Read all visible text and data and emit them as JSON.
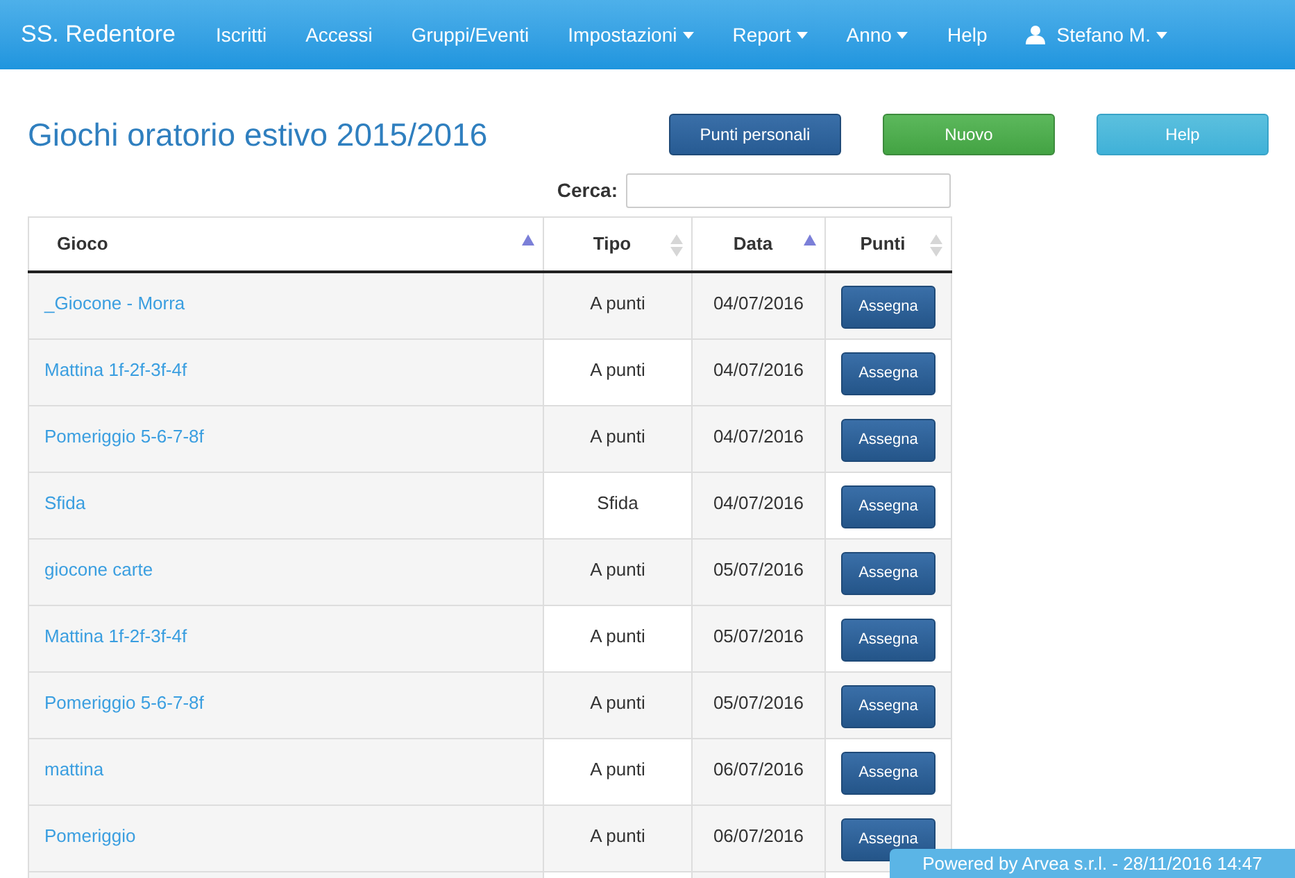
{
  "navbar": {
    "brand": "SS. Redentore",
    "items": [
      {
        "label": "Iscritti",
        "dropdown": false
      },
      {
        "label": "Accessi",
        "dropdown": false
      },
      {
        "label": "Gruppi/Eventi",
        "dropdown": false
      },
      {
        "label": "Impostazioni",
        "dropdown": true
      },
      {
        "label": "Report",
        "dropdown": true
      },
      {
        "label": "Anno",
        "dropdown": true
      },
      {
        "label": "Help",
        "dropdown": false
      }
    ],
    "user": {
      "label": "Stefano M.",
      "dropdown": true
    }
  },
  "page": {
    "title": "Giochi oratorio estivo 2015/2016",
    "buttons": [
      {
        "label": "Punti personali",
        "kind": "primary"
      },
      {
        "label": "Nuovo",
        "kind": "success"
      },
      {
        "label": "Help",
        "kind": "info"
      }
    ]
  },
  "search": {
    "label": "Cerca:"
  },
  "table": {
    "columns": [
      {
        "label": "Gioco",
        "sorted": true
      },
      {
        "label": "Tipo",
        "sorted": false
      },
      {
        "label": "Data",
        "sorted": true
      },
      {
        "label": "Punti",
        "sorted": false
      }
    ],
    "rows": [
      {
        "gioco": "_Giocone - Morra",
        "tipo": "A punti",
        "data": "04/07/2016",
        "action": "Assegna"
      },
      {
        "gioco": "Mattina 1f-2f-3f-4f",
        "tipo": "A punti",
        "data": "04/07/2016",
        "action": "Assegna"
      },
      {
        "gioco": "Pomeriggio 5-6-7-8f",
        "tipo": "A punti",
        "data": "04/07/2016",
        "action": "Assegna"
      },
      {
        "gioco": "Sfida",
        "tipo": "Sfida",
        "data": "04/07/2016",
        "action": "Assegna"
      },
      {
        "gioco": "giocone carte",
        "tipo": "A punti",
        "data": "05/07/2016",
        "action": "Assegna"
      },
      {
        "gioco": "Mattina 1f-2f-3f-4f",
        "tipo": "A punti",
        "data": "05/07/2016",
        "action": "Assegna"
      },
      {
        "gioco": "Pomeriggio 5-6-7-8f",
        "tipo": "A punti",
        "data": "05/07/2016",
        "action": "Assegna"
      },
      {
        "gioco": "mattina",
        "tipo": "A punti",
        "data": "06/07/2016",
        "action": "Assegna"
      },
      {
        "gioco": "Pomeriggio",
        "tipo": "A punti",
        "data": "06/07/2016",
        "action": "Assegna"
      }
    ]
  },
  "footer": "Powered by Arvea s.r.l. - 28/11/2016 14:47"
}
